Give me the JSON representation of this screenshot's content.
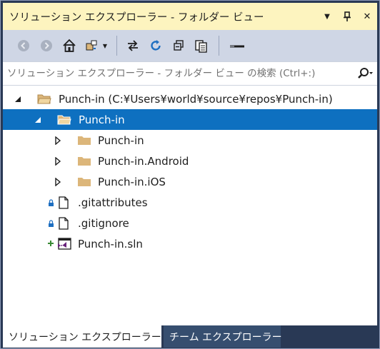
{
  "window": {
    "title": "ソリューション エクスプローラー - フォルダー ビュー",
    "dropdown_glyph": "▼",
    "pin_glyph": "⊥",
    "close_glyph": "✕"
  },
  "toolbar": {
    "items": [
      "back-icon",
      "forward-icon",
      "home-icon",
      "switch-views-icon",
      "sync-icon",
      "refresh-icon",
      "collapse-all-icon",
      "show-all-files-icon",
      "properties-icon"
    ]
  },
  "search": {
    "placeholder": "ソリューション エクスプローラー - フォルダー ビュー の検索 (Ctrl+:)"
  },
  "tree": {
    "root": {
      "label": "Punch-in (C:¥Users¥world¥source¥repos¥Punch-in)"
    },
    "folder": {
      "label": "Punch-in"
    },
    "subfolders": [
      {
        "label": "Punch-in"
      },
      {
        "label": "Punch-in.Android"
      },
      {
        "label": "Punch-in.iOS"
      }
    ],
    "files": [
      {
        "label": ".gitattributes"
      },
      {
        "label": ".gitignore"
      },
      {
        "label": "Punch-in.sln"
      }
    ]
  },
  "tabs": [
    {
      "label": "ソリューション エクスプローラー"
    },
    {
      "label": "チーム エクスプローラー"
    }
  ],
  "colors": {
    "titlebar": "#fdf4bf",
    "toolbar": "#cfd6e5",
    "selection": "#0e70c0",
    "frame": "#293955",
    "folder": "#dcb67a"
  }
}
